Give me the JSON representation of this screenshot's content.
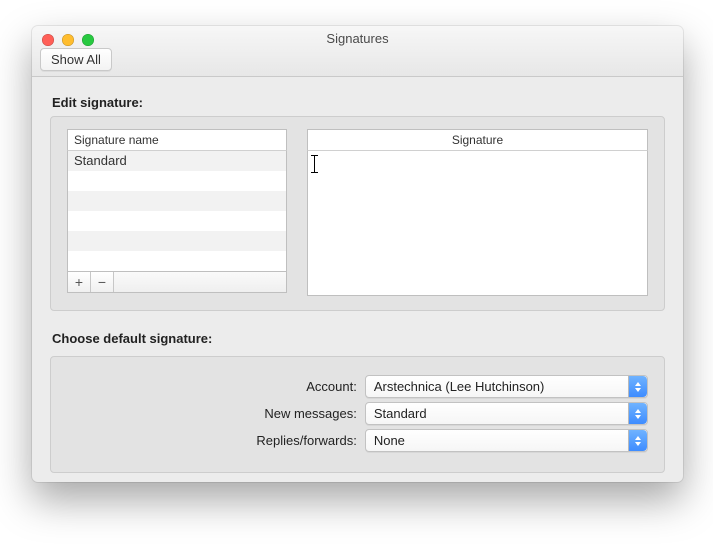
{
  "window": {
    "title": "Signatures"
  },
  "toolbar": {
    "show_all": "Show All"
  },
  "edit_section": {
    "heading": "Edit signature:",
    "list_header": "Signature name",
    "editor_header": "Signature",
    "rows": [
      "Standard",
      "",
      "",
      "",
      "",
      ""
    ],
    "editor_content": "",
    "add_label": "+",
    "remove_label": "−"
  },
  "default_section": {
    "heading": "Choose default signature:",
    "account_label": "Account:",
    "account_value": "Arstechnica (Lee Hutchinson)",
    "new_label": "New messages:",
    "new_value": "Standard",
    "replies_label": "Replies/forwards:",
    "replies_value": "None"
  }
}
